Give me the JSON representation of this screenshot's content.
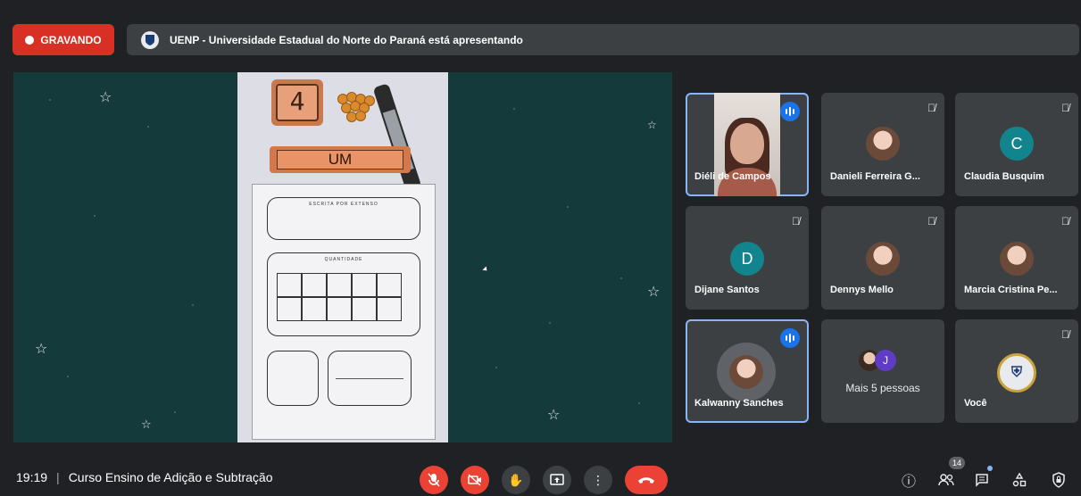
{
  "top": {
    "recording_label": "GRAVANDO",
    "presenting_text": "UENP - Universidade Estadual do Norte do Paraná está apresentando"
  },
  "stage": {
    "number_card": "4",
    "word_card": "UM",
    "box1_title": "ESCRITA POR EXTENSO",
    "box2_title": "QUANTIDADE"
  },
  "participants": [
    {
      "name": "Diéli de Campos",
      "state": "speaking",
      "kind": "video"
    },
    {
      "name": "Danieli Ferreira G...",
      "state": "muted",
      "kind": "photo"
    },
    {
      "name": "Claudia Busquim",
      "state": "muted",
      "kind": "letter",
      "initial": "C"
    },
    {
      "name": "Dijane Santos",
      "state": "muted",
      "kind": "letter",
      "initial": "D"
    },
    {
      "name": "Dennys Mello",
      "state": "muted",
      "kind": "photo"
    },
    {
      "name": "Marcia Cristina Pe...",
      "state": "muted",
      "kind": "photo"
    },
    {
      "name": "Kalwanny Sanches",
      "state": "speaking",
      "kind": "photo"
    },
    {
      "name": "Mais 5 pessoas",
      "state": "group",
      "kind": "group",
      "initial": "J"
    },
    {
      "name": "Você",
      "state": "muted",
      "kind": "crest"
    }
  ],
  "bottom": {
    "time": "19:19",
    "separator": "|",
    "meeting_title": "Curso Ensino de Adição e Subtração",
    "participant_count": "14"
  },
  "colors": {
    "recording": "#d93025",
    "stage_bg": "#143a3c",
    "tile_bg": "#3c4043",
    "speaking": "#1a73e8",
    "end_call": "#ea4335"
  }
}
